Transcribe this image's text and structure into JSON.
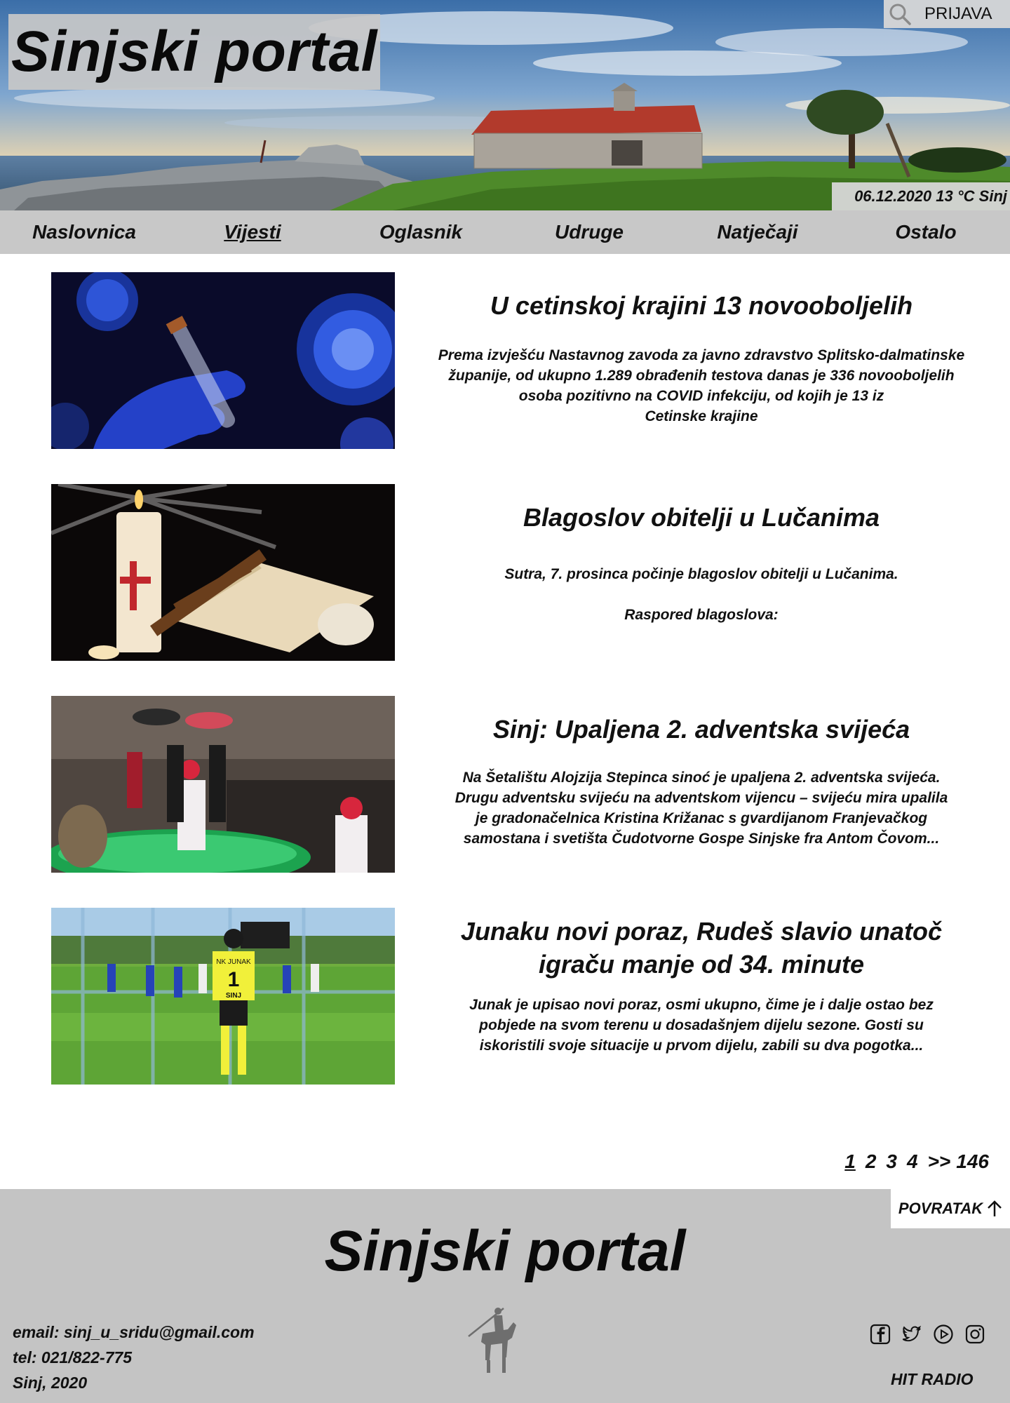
{
  "header": {
    "site_title": "Sinjski portal",
    "login_label": "PRIJAVA",
    "search_icon": "search-icon",
    "date_weather": "06.12.2020  13 °C Sinj"
  },
  "nav": {
    "items": [
      {
        "label": "Naslovnica"
      },
      {
        "label": "Vijesti",
        "active": true
      },
      {
        "label": "Oglasnik"
      },
      {
        "label": "Udruge"
      },
      {
        "label": "Natječaji"
      },
      {
        "label": "Ostalo"
      }
    ]
  },
  "articles": [
    {
      "title": "U cetinskoj krajini 13 novooboljelih",
      "excerpt": [
        "Prema izvješću Nastavnog zavoda za javno zdravstvo Splitsko-dalmatinske",
        "županije, od ukupno 1.289 obrađenih testova danas je 336 novooboljelih",
        "osoba pozitivno na COVID infekciju, od kojih je 13 iz",
        "Cetinske krajine"
      ]
    },
    {
      "title": "Blagoslov obitelji u Lučanima",
      "excerpt": [
        "Sutra, 7. prosinca počinje blagoslov obitelji u Lučanima.",
        "",
        "Raspored blagoslova:"
      ]
    },
    {
      "title": "Sinj: Upaljena 2. adventska svijeća",
      "excerpt": [
        "Na Šetalištu Alojzija Stepinca sinoć je upaljena 2. adventska svijeća.",
        "Drugu adventsku svijeću na adventskom vijencu – svijeću mira upalila",
        "je gradonačelnica Kristina Križanac s gvardijanom Franjevačkog",
        "samostana i svetišta Čudotvorne Gospe Sinjske fra Antom Čovom..."
      ]
    },
    {
      "title_lines": [
        "Junaku novi poraz, Rudeš slavio unatoč",
        "igraču manje od 34. minute"
      ],
      "excerpt": [
        "Junak je upisao novi poraz, osmi ukupno, čime je i dalje ostao bez",
        "pobjede na svom terenu u dosadašnjem dijelu sezone. Gosti su",
        "iskoristili svoje situacije u prvom dijelu, zabili su dva pogotka..."
      ],
      "jersey_text": "NK JUNAK",
      "jersey_number": "1",
      "jersey_town": "SINJ"
    }
  ],
  "pagination": {
    "pages": [
      "1",
      "2",
      "3",
      "4"
    ],
    "current": "1",
    "next": ">>",
    "last": "146"
  },
  "footer": {
    "back_to_top": "POVRATAK",
    "site_title": "Sinjski portal",
    "email": "email: sinj_u_sridu@gmail.com",
    "tel": "tel: 021/822-775",
    "place_year": "Sinj, 2020",
    "radio_link": "HIT RADIO",
    "social_icons": [
      "facebook-icon",
      "twitter-icon",
      "youtube-icon",
      "instagram-icon"
    ]
  }
}
